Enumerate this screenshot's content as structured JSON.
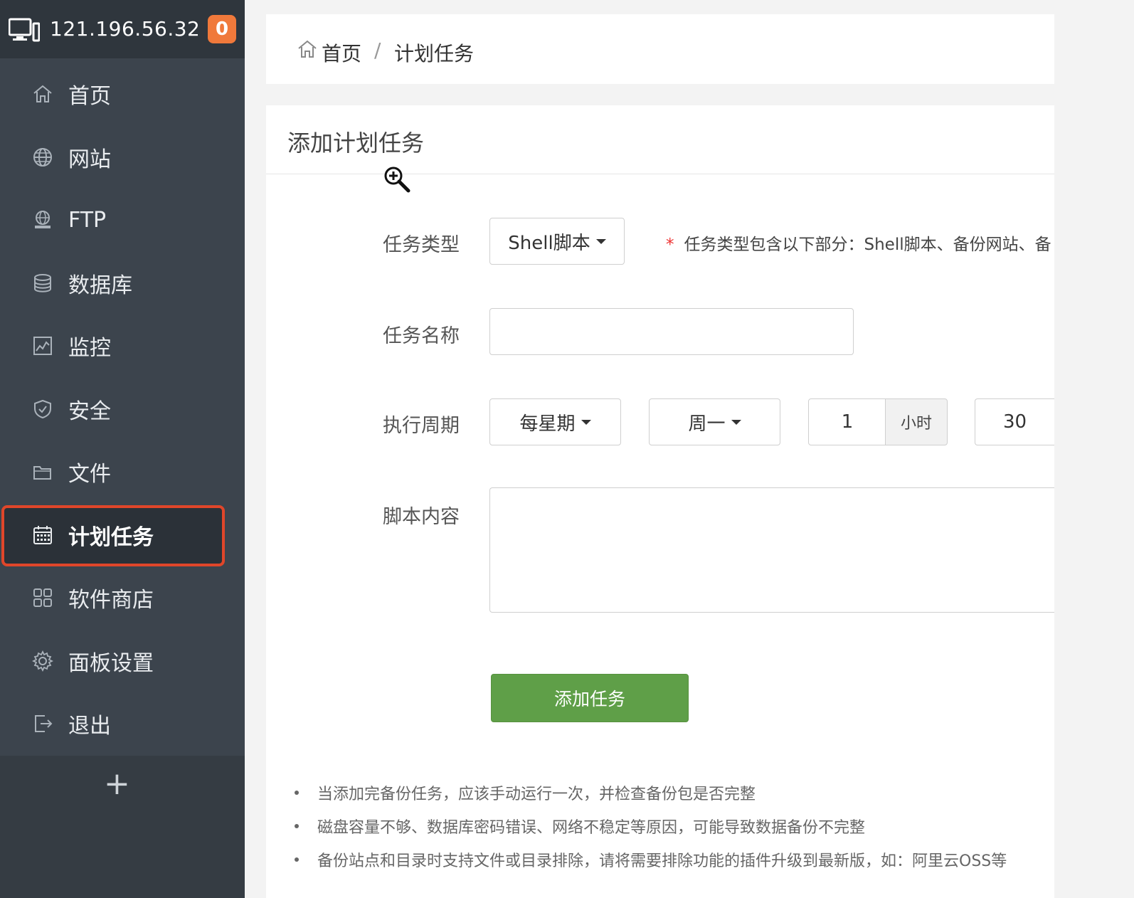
{
  "server": {
    "ip": "121.196.56.32",
    "badge": "0"
  },
  "sidebar": {
    "items": [
      {
        "label": "首页",
        "icon": "home-icon"
      },
      {
        "label": "网站",
        "icon": "globe-icon"
      },
      {
        "label": "FTP",
        "icon": "ftp-icon"
      },
      {
        "label": "数据库",
        "icon": "database-icon"
      },
      {
        "label": "监控",
        "icon": "monitor-chart-icon"
      },
      {
        "label": "安全",
        "icon": "shield-icon"
      },
      {
        "label": "文件",
        "icon": "folder-icon"
      },
      {
        "label": "计划任务",
        "icon": "calendar-icon",
        "active": true
      },
      {
        "label": "软件商店",
        "icon": "grid-icon"
      },
      {
        "label": "面板设置",
        "icon": "gear-icon"
      },
      {
        "label": "退出",
        "icon": "logout-icon"
      }
    ],
    "add_label": "+"
  },
  "breadcrumb": {
    "home": "首页",
    "separator": "/",
    "current": "计划任务"
  },
  "form": {
    "title": "添加计划任务",
    "task_type": {
      "label": "任务类型",
      "value": "Shell脚本"
    },
    "hint": "任务类型包含以下部分：Shell脚本、备份网站、备",
    "task_name": {
      "label": "任务名称",
      "value": ""
    },
    "cycle": {
      "label": "执行周期",
      "period": "每星期",
      "weekday": "周一",
      "hour": "1",
      "hour_unit": "小时",
      "minute": "30"
    },
    "script": {
      "label": "脚本内容",
      "value": ""
    },
    "submit_label": "添加任务"
  },
  "tips": [
    "当添加完备份任务，应该手动运行一次，并检查备份包是否完整",
    "磁盘容量不够、数据库密码错误、网络不稳定等原因，可能导致数据备份不完整",
    "备份站点和目录时支持文件或目录排除，请将需要排除功能的插件升级到最新版，如：阿里云OSS等"
  ],
  "colors": {
    "sidebar_bg": "#3c444d",
    "accent_green": "#5f9f48",
    "active_border": "#e0462a",
    "badge": "#f0793b"
  }
}
